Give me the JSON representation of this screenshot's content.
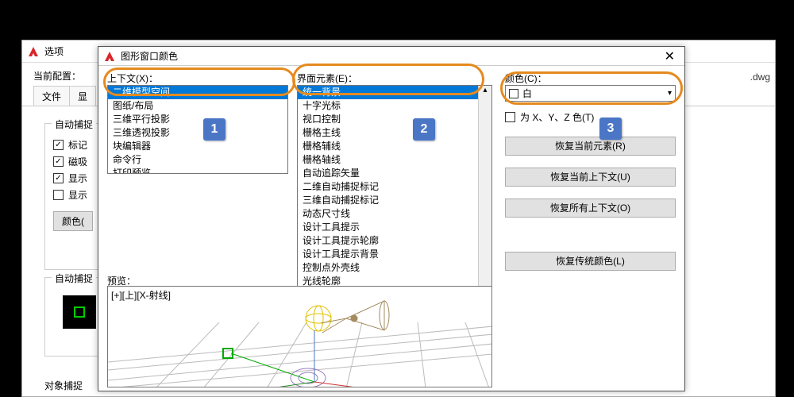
{
  "options_dialog": {
    "title": "选项",
    "profile_label": "当前配置：",
    "drawing_suffix": ".dwg",
    "tabs": [
      "文件",
      "显"
    ],
    "group_autosnap1": {
      "title": "自动捕捉",
      "chk_marker": "标记",
      "chk_magnet": "磁吸",
      "chk_show1": "显示",
      "chk_show2": "显示",
      "btn_color": "颜色("
    },
    "group_autosnap2": {
      "title": "自动捕捉"
    },
    "obj_snap_label": "对象捕捉"
  },
  "colors_dialog": {
    "title": "图形窗口颜色",
    "close": "✕",
    "label_context": "上下文(X)：",
    "label_element": "界面元素(E)：",
    "label_color": "颜色(C)：",
    "context_items": [
      "二维模型空间",
      "图纸/布局",
      "三维平行投影",
      "三维透视投影",
      "块编辑器",
      "命令行",
      "打印预览"
    ],
    "context_selected": 0,
    "element_items": [
      "统一背景",
      "十字光标",
      "视口控制",
      "栅格主线",
      "栅格辅线",
      "栅格轴线",
      "自动追踪矢量",
      "二维自动捕捉标记",
      "三维自动捕捉标记",
      "动态尺寸线",
      "设计工具提示",
      "设计工具提示轮廓",
      "设计工具提示背景",
      "控制点外壳线",
      "光线轮廓"
    ],
    "element_selected": 0,
    "color_value": "白",
    "chk_axis": "为 X、Y、Z         色(T)",
    "btn_restore_element": "恢复当前元素(R)",
    "btn_restore_context": "恢复当前上下文(U)",
    "btn_restore_all": "恢复所有上下文(O)",
    "btn_restore_classic": "恢复传统颜色(L)",
    "preview_label": "预览：",
    "preview_caption": "[+][上][X-射线]"
  },
  "badges": {
    "b1": "1",
    "b2": "2",
    "b3": "3"
  }
}
